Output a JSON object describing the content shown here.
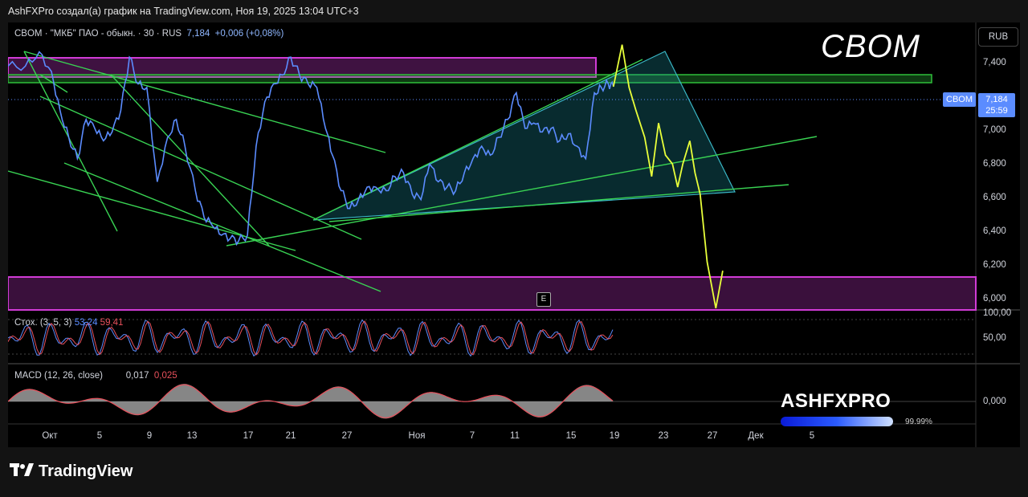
{
  "caption": "AshFXPro создал(а) график на TradingView.com, Ноя 19, 2025 13:04 UTC+3",
  "header": {
    "symbol": "CBOM · \"МКБ\" ПАО - обыкн. · 30 · RUS",
    "price": "7,184",
    "change": "+0,006 (+0,08%)"
  },
  "big_ticker": "CBOM",
  "currency": "RUB",
  "price_badge": "CBOM",
  "price_tag": {
    "price": "7,184",
    "countdown": "25:59"
  },
  "earnings_marker": "E",
  "stoch": {
    "label": "Стох. (3, 5, 3)",
    "k": "53,24",
    "d": "59,41"
  },
  "macd": {
    "label": "MACD (12, 26, close)",
    "macd": "0,017",
    "signal": "0,025"
  },
  "logo": {
    "wordmark": "ASHFXPRO",
    "percent": "99.99%"
  },
  "footer_brand": "TradingView",
  "colors": {
    "price_line": "#5b8cff",
    "projection": "#e8ff3a",
    "trendline": "#39d353",
    "zone_magenta": "#d13bd6",
    "zone_green": "#2fbf3a",
    "triangle": "#1c9aa8",
    "macd_hist": "#9e9e9e",
    "macd_line": "#e8505b",
    "stoch_k": "#5b8cff",
    "stoch_d": "#e8505b"
  },
  "chart_data": {
    "type": "line",
    "y_axis": {
      "ticks": [
        "7,400",
        "7,200",
        "7,000",
        "6,800",
        "6,600",
        "6,400",
        "6,200",
        "6,000"
      ],
      "ylim": [
        5.93,
        7.5
      ]
    },
    "x_axis": {
      "ticks": [
        "Окт",
        "5",
        "9",
        "13",
        "17",
        "21",
        "27",
        "Ноя",
        "7",
        "11",
        "15",
        "19",
        "23",
        "27",
        "Дек",
        "5"
      ]
    },
    "series": [
      {
        "role": "price",
        "points": [
          [
            0,
            7.3
          ],
          [
            1,
            7.3
          ],
          [
            1.8,
            7.38
          ],
          [
            2.5,
            7.27
          ],
          [
            3,
            7.05
          ],
          [
            3.5,
            6.9
          ],
          [
            4,
            6.78
          ],
          [
            4.5,
            7.0
          ],
          [
            5,
            6.95
          ],
          [
            5.5,
            6.88
          ],
          [
            6,
            6.93
          ],
          [
            6.5,
            7.05
          ],
          [
            7,
            7.35
          ],
          [
            7.5,
            7.2
          ],
          [
            8,
            7.18
          ],
          [
            8.6,
            6.65
          ],
          [
            9.2,
            6.9
          ],
          [
            9.7,
            7.0
          ],
          [
            10.2,
            6.85
          ],
          [
            10.8,
            6.6
          ],
          [
            11.3,
            6.45
          ],
          [
            11.8,
            6.4
          ],
          [
            12.3,
            6.35
          ],
          [
            12.8,
            6.33
          ],
          [
            13.3,
            6.32
          ],
          [
            13.8,
            6.35
          ],
          [
            14.3,
            6.85
          ],
          [
            14.8,
            7.1
          ],
          [
            15.3,
            7.2
          ],
          [
            15.8,
            7.25
          ],
          [
            16.3,
            7.35
          ],
          [
            16.8,
            7.25
          ],
          [
            17.3,
            7.2
          ],
          [
            17.8,
            7.18
          ],
          [
            18.3,
            6.95
          ],
          [
            18.7,
            6.8
          ],
          [
            19.2,
            6.6
          ],
          [
            19.7,
            6.5
          ],
          [
            20.2,
            6.55
          ],
          [
            20.7,
            6.62
          ],
          [
            21.2,
            6.62
          ],
          [
            21.8,
            6.6
          ],
          [
            22.3,
            6.68
          ],
          [
            22.8,
            6.7
          ],
          [
            23.3,
            6.58
          ],
          [
            23.8,
            6.55
          ],
          [
            24.3,
            6.75
          ],
          [
            24.8,
            6.65
          ],
          [
            25.3,
            6.62
          ],
          [
            25.8,
            6.6
          ],
          [
            26.3,
            6.7
          ],
          [
            26.8,
            6.78
          ],
          [
            27.3,
            6.85
          ],
          [
            27.8,
            6.8
          ],
          [
            28.3,
            6.9
          ],
          [
            28.8,
            7.0
          ],
          [
            29.3,
            7.15
          ],
          [
            29.8,
            6.95
          ],
          [
            30.3,
            6.98
          ],
          [
            30.8,
            6.93
          ],
          [
            31.3,
            6.95
          ],
          [
            31.8,
            6.88
          ],
          [
            32.3,
            6.92
          ],
          [
            32.8,
            6.85
          ],
          [
            33.3,
            6.78
          ],
          [
            33.8,
            7.15
          ],
          [
            34.2,
            7.18
          ],
          [
            34.6,
            7.2
          ],
          [
            34.9,
            7.184
          ]
        ]
      },
      {
        "role": "projection",
        "points": [
          [
            34.9,
            7.184
          ],
          [
            35.4,
            7.42
          ],
          [
            35.8,
            7.18
          ],
          [
            36.2,
            7.05
          ],
          [
            36.7,
            6.9
          ],
          [
            37.1,
            6.68
          ],
          [
            37.5,
            6.98
          ],
          [
            37.9,
            6.8
          ],
          [
            38.3,
            6.75
          ],
          [
            38.6,
            6.62
          ],
          [
            38.9,
            6.75
          ],
          [
            39.3,
            6.88
          ],
          [
            39.6,
            6.7
          ],
          [
            39.9,
            6.58
          ],
          [
            40.3,
            6.2
          ],
          [
            40.8,
            5.94
          ],
          [
            41.2,
            6.15
          ]
        ]
      }
    ]
  }
}
